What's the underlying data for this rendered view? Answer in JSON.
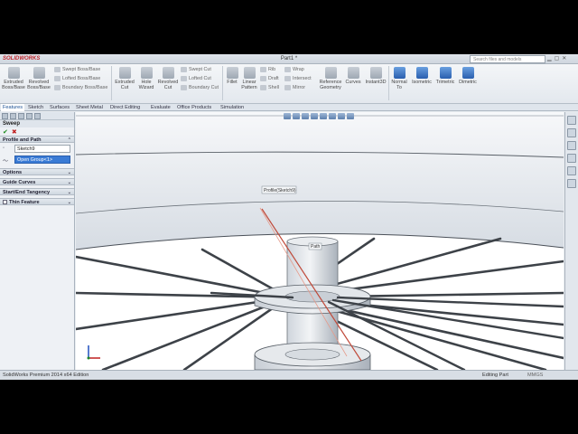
{
  "app": {
    "logo": "SOLIDWORKS",
    "title": "Part1 *"
  },
  "search": {
    "placeholder": "Search files and models"
  },
  "ribbon": {
    "extruded_boss": "Extruded\nBoss/Base",
    "revolved_boss": "Revolved\nBoss/Base",
    "swept_boss": "Swept Boss/Base",
    "lofted_boss": "Lofted Boss/Base",
    "boundary_boss": "Boundary Boss/Base",
    "extruded_cut": "Extruded\nCut",
    "hole_wizard": "Hole\nWizard",
    "revolved_cut": "Revolved\nCut",
    "swept_cut": "Swept Cut",
    "lofted_cut": "Lofted Cut",
    "boundary_cut": "Boundary Cut",
    "fillet": "Fillet",
    "linear_pattern": "Linear\nPattern",
    "rib": "Rib",
    "draft": "Draft",
    "shell": "Shell",
    "wrap": "Wrap",
    "intersect": "Intersect",
    "mirror": "Mirror",
    "reference_geometry": "Reference\nGeometry",
    "curves": "Curves",
    "instant3d": "Instant3D",
    "normal_to": "Normal\nTo",
    "isometric": "Isometric",
    "trimetric": "Trimetric",
    "dimetric": "Dimetric"
  },
  "tabs": [
    "Features",
    "Sketch",
    "Surfaces",
    "Sheet Metal",
    "Direct Editing",
    "Evaluate",
    "Office Products",
    "Simulation"
  ],
  "property_manager": {
    "title": "Sweep",
    "profile_and_path": "Profile and Path",
    "profile_value": "Sketch9",
    "path_value": "Open Group<1>",
    "options": "Options",
    "guide_curves": "Guide Curves",
    "start_end_tangency": "Start/End Tangency",
    "thin_feature": "Thin Feature"
  },
  "viewport": {
    "callout_profile": "Profile(Sketch9)",
    "callout_path": "Path"
  },
  "status": {
    "left": "SolidWorks Premium 2014 x64 Edition",
    "mode": "Editing Part",
    "units": "MMGS"
  }
}
